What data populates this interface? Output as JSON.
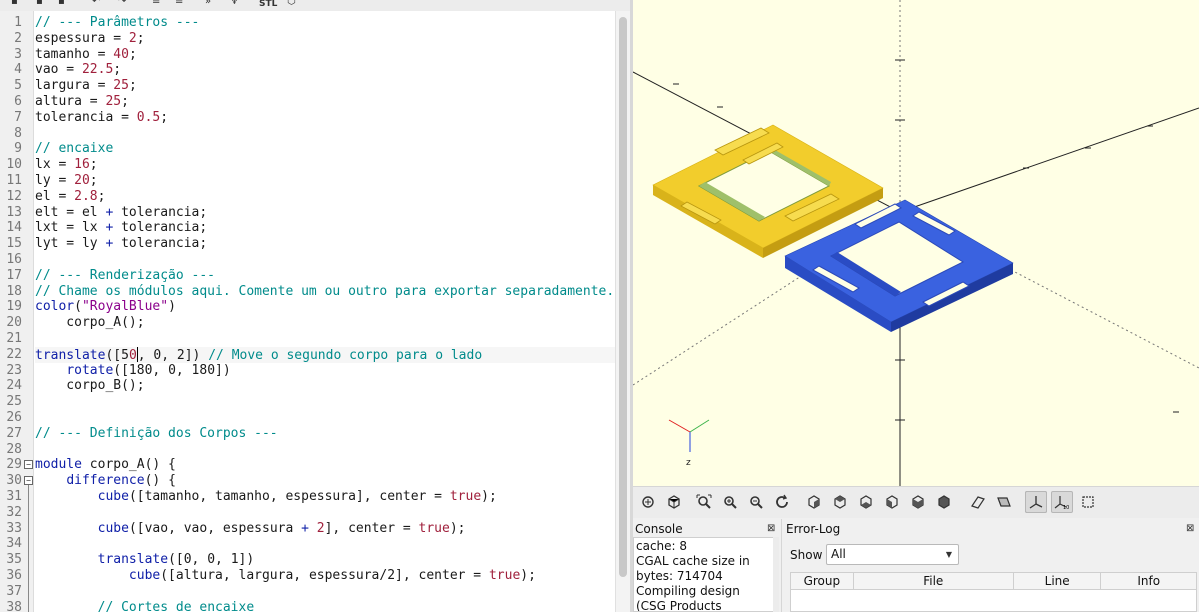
{
  "editor": {
    "lines": [
      [
        [
          "c",
          "// --- Parâmetros ---"
        ]
      ],
      [
        [
          "p",
          "espessura = "
        ],
        [
          "n",
          "2"
        ],
        [
          "p",
          ";"
        ]
      ],
      [
        [
          "p",
          "tamanho = "
        ],
        [
          "n",
          "40"
        ],
        [
          "p",
          ";"
        ]
      ],
      [
        [
          "p",
          "vao = "
        ],
        [
          "n",
          "22.5"
        ],
        [
          "p",
          ";"
        ]
      ],
      [
        [
          "p",
          "largura = "
        ],
        [
          "n",
          "25"
        ],
        [
          "p",
          ";"
        ]
      ],
      [
        [
          "p",
          "altura = "
        ],
        [
          "n",
          "25"
        ],
        [
          "p",
          ";"
        ]
      ],
      [
        [
          "p",
          "tolerancia = "
        ],
        [
          "n",
          "0.5"
        ],
        [
          "p",
          ";"
        ]
      ],
      [],
      [
        [
          "c",
          "// encaixe"
        ]
      ],
      [
        [
          "p",
          "lx = "
        ],
        [
          "n",
          "16"
        ],
        [
          "p",
          ";"
        ]
      ],
      [
        [
          "p",
          "ly = "
        ],
        [
          "n",
          "20"
        ],
        [
          "p",
          ";"
        ]
      ],
      [
        [
          "p",
          "el = "
        ],
        [
          "n",
          "2.8"
        ],
        [
          "p",
          ";"
        ]
      ],
      [
        [
          "p",
          "elt = el "
        ],
        [
          "k",
          "+"
        ],
        [
          "p",
          " tolerancia;"
        ]
      ],
      [
        [
          "p",
          "lxt = lx "
        ],
        [
          "k",
          "+"
        ],
        [
          "p",
          " tolerancia;"
        ]
      ],
      [
        [
          "p",
          "lyt = ly "
        ],
        [
          "k",
          "+"
        ],
        [
          "p",
          " tolerancia;"
        ]
      ],
      [],
      [
        [
          "c",
          "// --- Renderização ---"
        ]
      ],
      [
        [
          "c",
          "// Chame os módulos aqui. Comente um ou outro para exportar separadamente."
        ]
      ],
      [
        [
          "k",
          "color"
        ],
        [
          "p",
          "("
        ],
        [
          "s",
          "\"RoyalBlue\""
        ],
        [
          "p",
          ")"
        ]
      ],
      [
        [
          "p",
          "    corpo_A();"
        ]
      ],
      [],
      [
        [
          "k",
          "translate"
        ],
        [
          "p",
          "([5"
        ],
        [
          "x",
          "0"
        ],
        [
          "p",
          ", 0, 2]) "
        ],
        [
          "c",
          "// Move o segundo corpo para o lado"
        ]
      ],
      [
        [
          "p",
          "    "
        ],
        [
          "k",
          "rotate"
        ],
        [
          "p",
          "([180, 0, 180])"
        ]
      ],
      [
        [
          "p",
          "    corpo_B();"
        ]
      ],
      [],
      [],
      [
        [
          "c",
          "// --- Definição dos Corpos ---"
        ]
      ],
      [],
      [
        [
          "k",
          "module"
        ],
        [
          "p",
          " corpo_A() {"
        ]
      ],
      [
        [
          "p",
          "    "
        ],
        [
          "k",
          "difference"
        ],
        [
          "p",
          "() {"
        ]
      ],
      [
        [
          "p",
          "        "
        ],
        [
          "k",
          "cube"
        ],
        [
          "p",
          "([tamanho, tamanho, espessura], center = "
        ],
        [
          "n",
          "true"
        ],
        [
          "p",
          ");"
        ]
      ],
      [],
      [
        [
          "p",
          "        "
        ],
        [
          "k",
          "cube"
        ],
        [
          "p",
          "([vao, vao, espessura "
        ],
        [
          "k",
          "+"
        ],
        [
          "p",
          " "
        ],
        [
          "n",
          "2"
        ],
        [
          "p",
          "], center = "
        ],
        [
          "n",
          "true"
        ],
        [
          "p",
          ");"
        ]
      ],
      [],
      [
        [
          "p",
          "        "
        ],
        [
          "k",
          "translate"
        ],
        [
          "p",
          "([0, 0, 1])"
        ]
      ],
      [
        [
          "p",
          "            "
        ],
        [
          "k",
          "cube"
        ],
        [
          "p",
          "([altura, largura, espessura/2], center = "
        ],
        [
          "n",
          "true"
        ],
        [
          "p",
          ");"
        ]
      ],
      [],
      [
        [
          "p",
          "        "
        ],
        [
          "c",
          "// Cortes de encaixe"
        ]
      ]
    ],
    "current_line": 22
  },
  "toolbar": {
    "stl_label": "STL"
  },
  "console": {
    "title": "Console",
    "lines": [
      "cache: 8",
      "CGAL cache size in",
      "bytes: 714704",
      "Compiling design",
      "(CSG Products"
    ]
  },
  "error_log": {
    "title": "Error-Log",
    "show_label": "Show",
    "show_value": "All",
    "columns": [
      "Group",
      "File",
      "Line",
      "Info"
    ]
  },
  "viewport": {
    "background": "#ffffe5",
    "part_a_color": "#f2cd2c",
    "part_b_color": "#3a62e0",
    "axis_labels": [
      "z"
    ]
  },
  "view_toolbar": {
    "icons": [
      "preview-render-icon",
      "render-icon",
      "zoom-all-icon",
      "zoom-in-icon",
      "zoom-out-icon",
      "reset-view-icon",
      "view-right-icon",
      "view-top-icon",
      "view-bottom-icon",
      "view-left-icon",
      "view-front-icon",
      "view-back-icon",
      "view-diagonal-icon",
      "perspective-icon",
      "orthogonal-icon",
      "show-axes-icon",
      "show-scale-markers-icon",
      "show-edges-icon"
    ]
  }
}
